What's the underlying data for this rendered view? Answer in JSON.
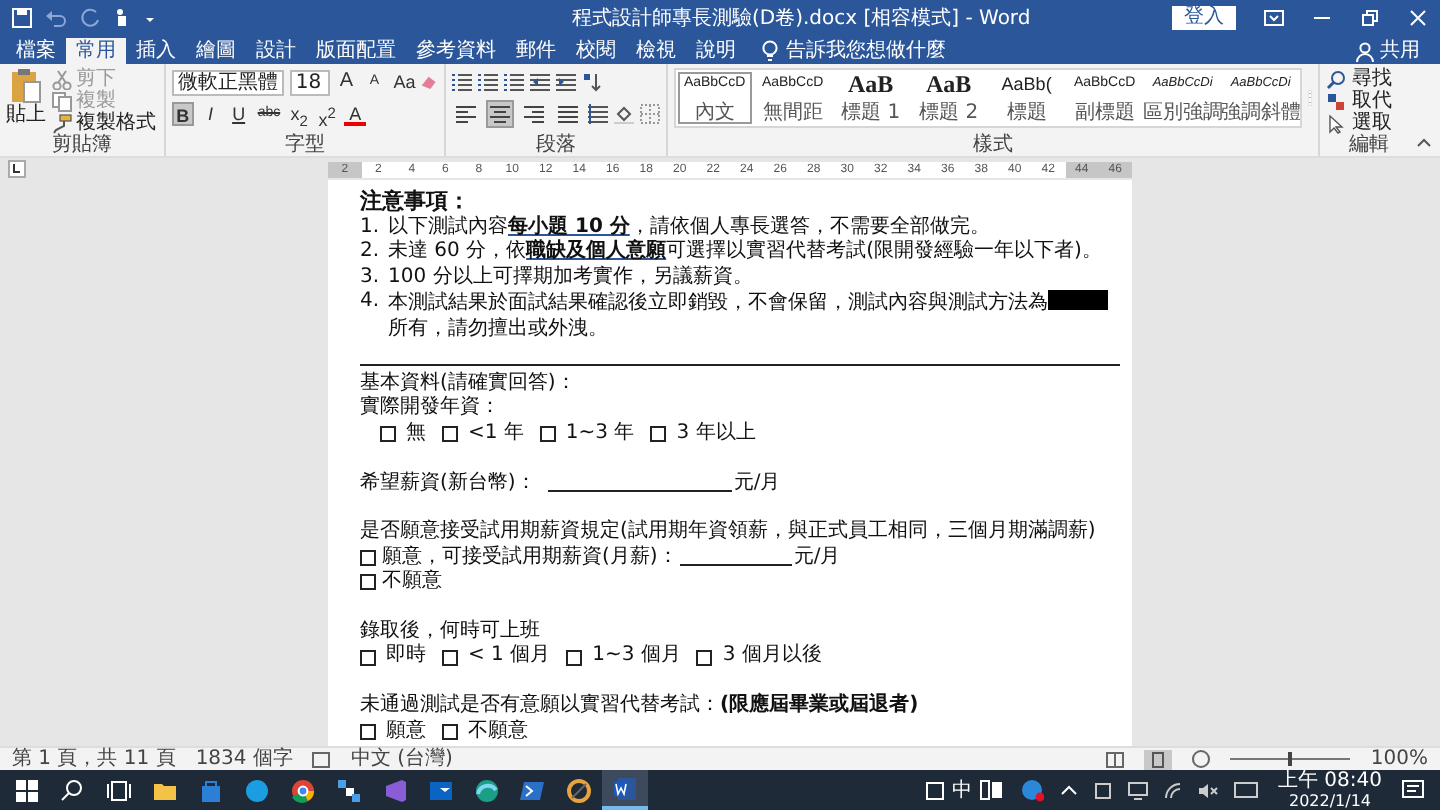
{
  "title_bar": {
    "title": "程式設計師專長測驗(D卷).docx [相容模式] - Word",
    "sign_in": "登入",
    "share": "共用"
  },
  "ribbon_tabs": [
    {
      "label": "檔案",
      "selected": false
    },
    {
      "label": "常用",
      "selected": true
    },
    {
      "label": "插入",
      "selected": false
    },
    {
      "label": "繪圖",
      "selected": false
    },
    {
      "label": "設計",
      "selected": false
    },
    {
      "label": "版面配置",
      "selected": false
    },
    {
      "label": "參考資料",
      "selected": false
    },
    {
      "label": "郵件",
      "selected": false
    },
    {
      "label": "校閱",
      "selected": false
    },
    {
      "label": "檢視",
      "selected": false
    },
    {
      "label": "說明",
      "selected": false
    }
  ],
  "tell_me": "告訴我您想做什麼",
  "clipboard": {
    "paste": "貼上",
    "group": "剪貼簿",
    "items": [
      {
        "kind": "cut",
        "label": "剪下",
        "disabled": true
      },
      {
        "kind": "copy",
        "label": "複製",
        "disabled": true
      },
      {
        "kind": "painter",
        "label": "複製格式",
        "disabled": false
      }
    ]
  },
  "font": {
    "name": "微軟正黑體",
    "size": "18",
    "group": "字型",
    "row1": [
      {
        "kind": "grow",
        "label": "A"
      },
      {
        "kind": "shrink",
        "label": "A"
      },
      {
        "kind": "case",
        "label": "Aa"
      }
    ],
    "row2": [
      {
        "kind": "bold",
        "label": "B",
        "selected": true
      },
      {
        "kind": "italic",
        "label": "I",
        "selected": false
      },
      {
        "kind": "underline",
        "label": "U",
        "selected": false
      },
      {
        "kind": "strike",
        "label": "abc",
        "selected": false
      },
      {
        "kind": "sub",
        "label": "x$_{2}$",
        "selected": false
      },
      {
        "kind": "sup",
        "label": "x$^{2}$",
        "selected": false
      },
      {
        "kind": "color",
        "label": "A",
        "selected": false
      }
    ]
  },
  "paragraph": {
    "group": "段落",
    "align": [
      {
        "kind": "left",
        "selected": false
      },
      {
        "kind": "center",
        "selected": true
      },
      {
        "kind": "right",
        "selected": false
      },
      {
        "kind": "justify",
        "selected": false
      }
    ]
  },
  "styles": {
    "group": "樣式",
    "items": [
      {
        "sample": "AaBbCcD",
        "label": "內文",
        "kind": "normal",
        "selected": true
      },
      {
        "sample": "AaBbCcD",
        "label": "無間距",
        "kind": "normal",
        "selected": false
      },
      {
        "sample": "AaB",
        "label": "標題 1",
        "kind": "heading",
        "selected": false
      },
      {
        "sample": "AaB",
        "label": "標題 2",
        "kind": "heading",
        "selected": false
      },
      {
        "sample": "AaBb(",
        "label": "標題",
        "kind": "title",
        "selected": false
      },
      {
        "sample": "AaBbCcD",
        "label": "副標題",
        "kind": "normal",
        "selected": false
      },
      {
        "sample": "AaBbCcDi",
        "label": "區別強調",
        "kind": "italic",
        "selected": false
      },
      {
        "sample": "AaBbCcDi",
        "label": "強調斜體",
        "kind": "italic",
        "selected": false
      }
    ]
  },
  "editing": {
    "group": "編輯",
    "items": [
      {
        "kind": "find",
        "label": "尋找"
      },
      {
        "kind": "replace",
        "label": "取代"
      },
      {
        "kind": "select",
        "label": "選取"
      }
    ]
  },
  "ruler": [
    {
      "label": "2",
      "margin": true
    },
    {
      "label": "2",
      "margin": false
    },
    {
      "label": "4",
      "margin": false
    },
    {
      "label": "6",
      "margin": false
    },
    {
      "label": "8",
      "margin": false
    },
    {
      "label": "10",
      "margin": false
    },
    {
      "label": "12",
      "margin": false
    },
    {
      "label": "14",
      "margin": false
    },
    {
      "label": "16",
      "margin": false
    },
    {
      "label": "18",
      "margin": false
    },
    {
      "label": "20",
      "margin": false
    },
    {
      "label": "22",
      "margin": false
    },
    {
      "label": "24",
      "margin": false
    },
    {
      "label": "26",
      "margin": false
    },
    {
      "label": "28",
      "margin": false
    },
    {
      "label": "30",
      "margin": false
    },
    {
      "label": "32",
      "margin": false
    },
    {
      "label": "34",
      "margin": false
    },
    {
      "label": "36",
      "margin": false
    },
    {
      "label": "38",
      "margin": false
    },
    {
      "label": "40",
      "margin": false
    },
    {
      "label": "42",
      "margin": false
    },
    {
      "label": "44",
      "margin": true
    },
    {
      "label": "46",
      "margin": true
    }
  ],
  "document": {
    "heading": "注意事項：",
    "notice": [
      {
        "number": "1.",
        "text": "以下測試內容**每小題 10 分**，請依個人專長選答，不需要全部做完。"
      },
      {
        "number": "2.",
        "text": "未達 60 分，依**職缺及個人意願**可選擇以實習代替考試(限開發經驗一年以下者)。"
      },
      {
        "number": "3.",
        "text": "100 分以上可擇期加考實作，另議薪資。"
      },
      {
        "number": "4.",
        "text": "本測試結果於面試結果確認後立即銷毀，不會保留，測試內容與測試方法為",
        "redacted": true,
        "text_after": "所有，請勿擅出或外洩。"
      }
    ],
    "form": [
      {
        "kind": "text",
        "text": "基本資料(請確實回答)："
      },
      {
        "kind": "text",
        "text": "實際開發年資："
      },
      {
        "kind": "options",
        "indent": true,
        "options": [
          {
            "label": "無",
            "checked": false
          },
          {
            "label": "<1 年",
            "checked": false
          },
          {
            "label": "1~3 年",
            "checked": false
          },
          {
            "label": "3 年以上",
            "checked": false
          }
        ]
      },
      {
        "kind": "blank"
      },
      {
        "kind": "fill",
        "text": "希望薪資(新台幣)：",
        "suffix": "元/月"
      },
      {
        "kind": "blank"
      },
      {
        "kind": "text",
        "text": "是否願意接受試用期薪資規定(試用期年資領薪，與正式員工相同，三個月期滿調薪)"
      },
      {
        "kind": "check",
        "label": "願意，可接受試用期薪資(月薪)：",
        "checked": false,
        "suffix": "元/月"
      },
      {
        "kind": "check",
        "label": "不願意",
        "checked": false
      },
      {
        "kind": "blank"
      },
      {
        "kind": "text",
        "text": "錄取後，何時可上班"
      },
      {
        "kind": "options",
        "indent": false,
        "options": [
          {
            "label": "即時",
            "checked": false
          },
          {
            "label": "< 1 個月",
            "checked": false
          },
          {
            "label": "1~3 個月",
            "checked": false
          },
          {
            "label": "3 個月以後",
            "checked": false
          }
        ]
      },
      {
        "kind": "blank"
      },
      {
        "kind": "text",
        "text": "未通過測試是否有意願以實習代替考試：**(限應屆畢業或屆退者)**"
      },
      {
        "kind": "options",
        "indent": false,
        "options": [
          {
            "label": "願意",
            "checked": false
          },
          {
            "label": "不願意",
            "checked": false
          }
        ]
      }
    ]
  },
  "status_bar": {
    "page": "第 1 頁，共 11 頁",
    "words": "1834 個字",
    "language": "中文 (台灣)",
    "zoom": "100%",
    "level": 0.5
  },
  "taskbar": {
    "ime": "中",
    "time": "上午 08:40",
    "date": "2022/1/14"
  }
}
